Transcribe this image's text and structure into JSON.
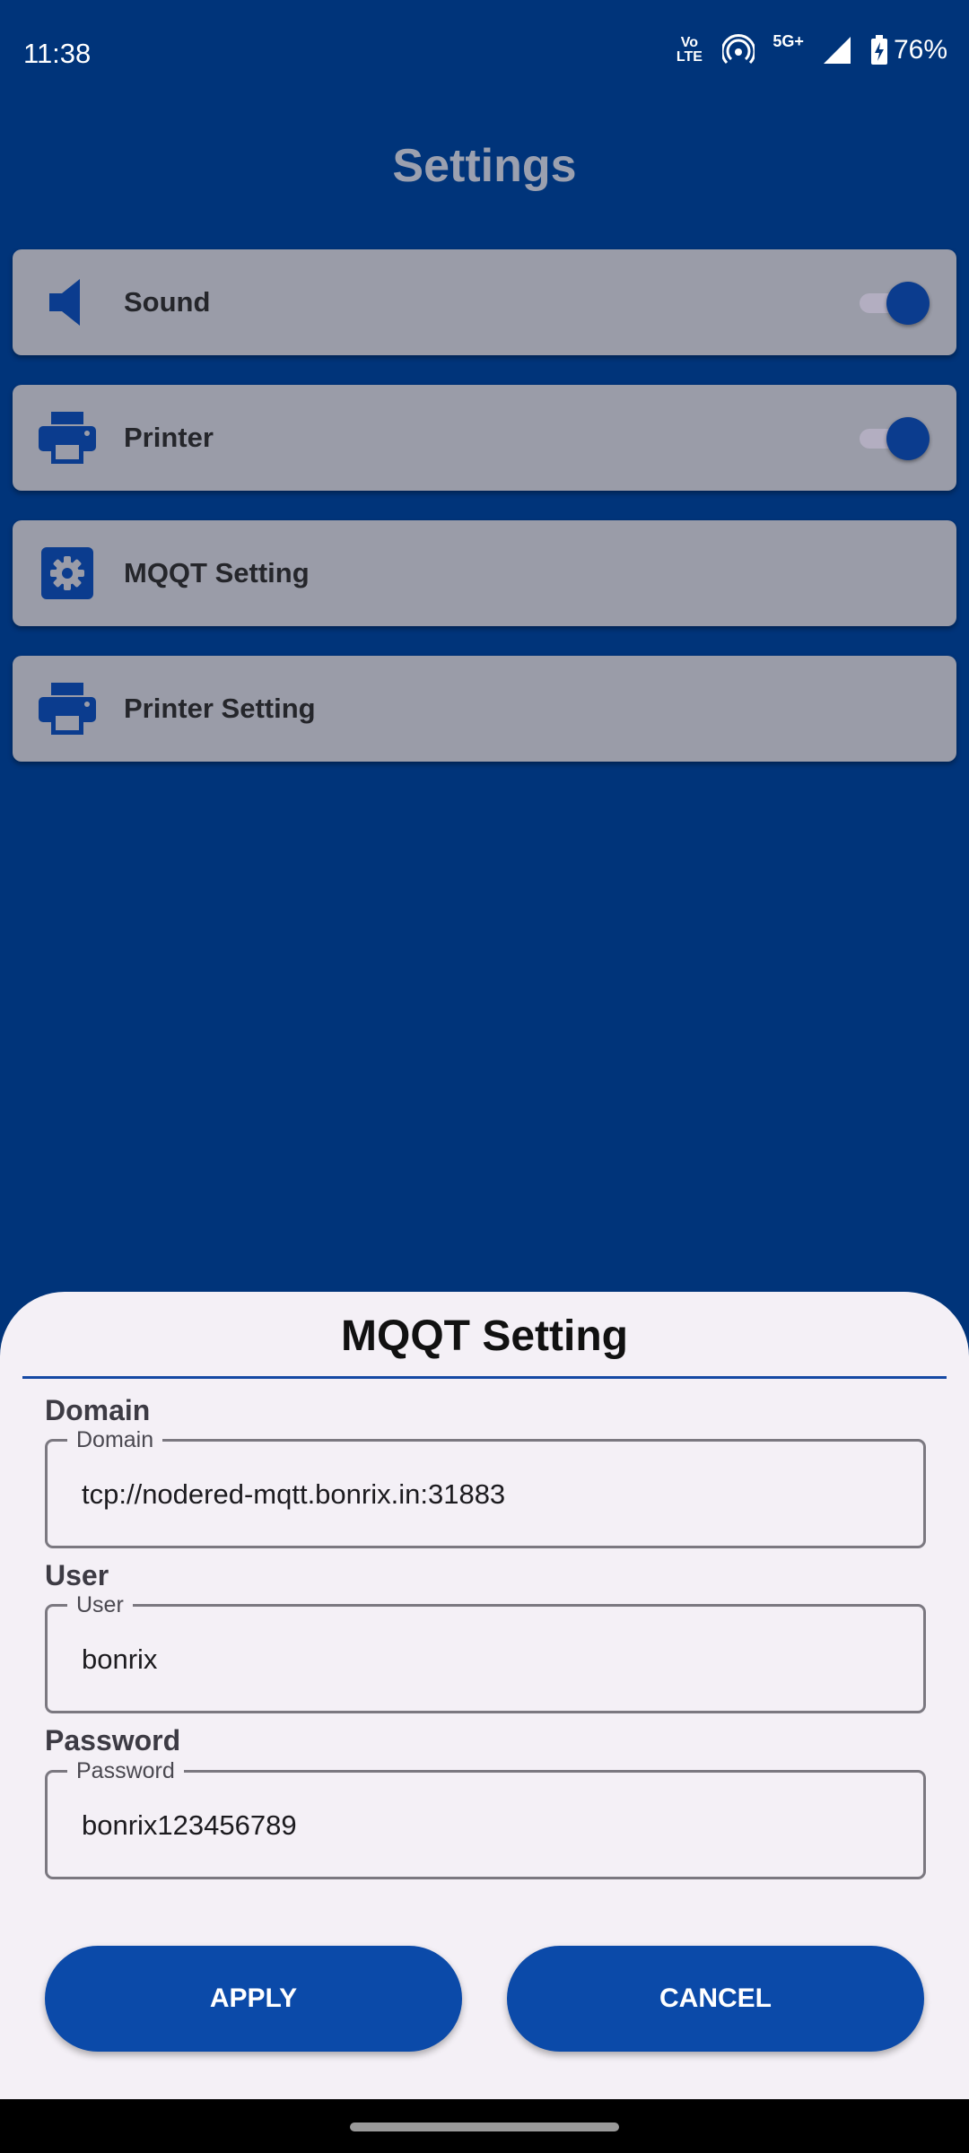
{
  "status_bar": {
    "time": "11:38",
    "volte_top": "Vo",
    "volte_bottom": "LTE",
    "network": "5G+",
    "battery": "76%"
  },
  "page": {
    "title": "Settings"
  },
  "settings": [
    {
      "label": "Sound",
      "icon": "speaker-icon",
      "toggle": true,
      "toggle_on": true
    },
    {
      "label": "Printer",
      "icon": "printer-icon",
      "toggle": true,
      "toggle_on": true
    },
    {
      "label": "MQQT Setting",
      "icon": "gear-icon",
      "toggle": false
    },
    {
      "label": "Printer Setting",
      "icon": "printer-icon",
      "toggle": false
    }
  ],
  "dialog": {
    "title": "MQQT Setting",
    "domain": {
      "section_label": "Domain",
      "floating_label": "Domain",
      "value": "tcp://nodered-mqtt.bonrix.in:31883"
    },
    "user": {
      "section_label": "User",
      "floating_label": "User",
      "value": "bonrix"
    },
    "password": {
      "section_label": "Password",
      "floating_label": "Password",
      "value": "bonrix123456789"
    },
    "apply_label": "APPLY",
    "cancel_label": "CANCEL"
  },
  "colors": {
    "background": "#00347A",
    "card": "#9A9CA8",
    "accent": "#0B4AA9",
    "sheet": "#F4F0F6"
  }
}
